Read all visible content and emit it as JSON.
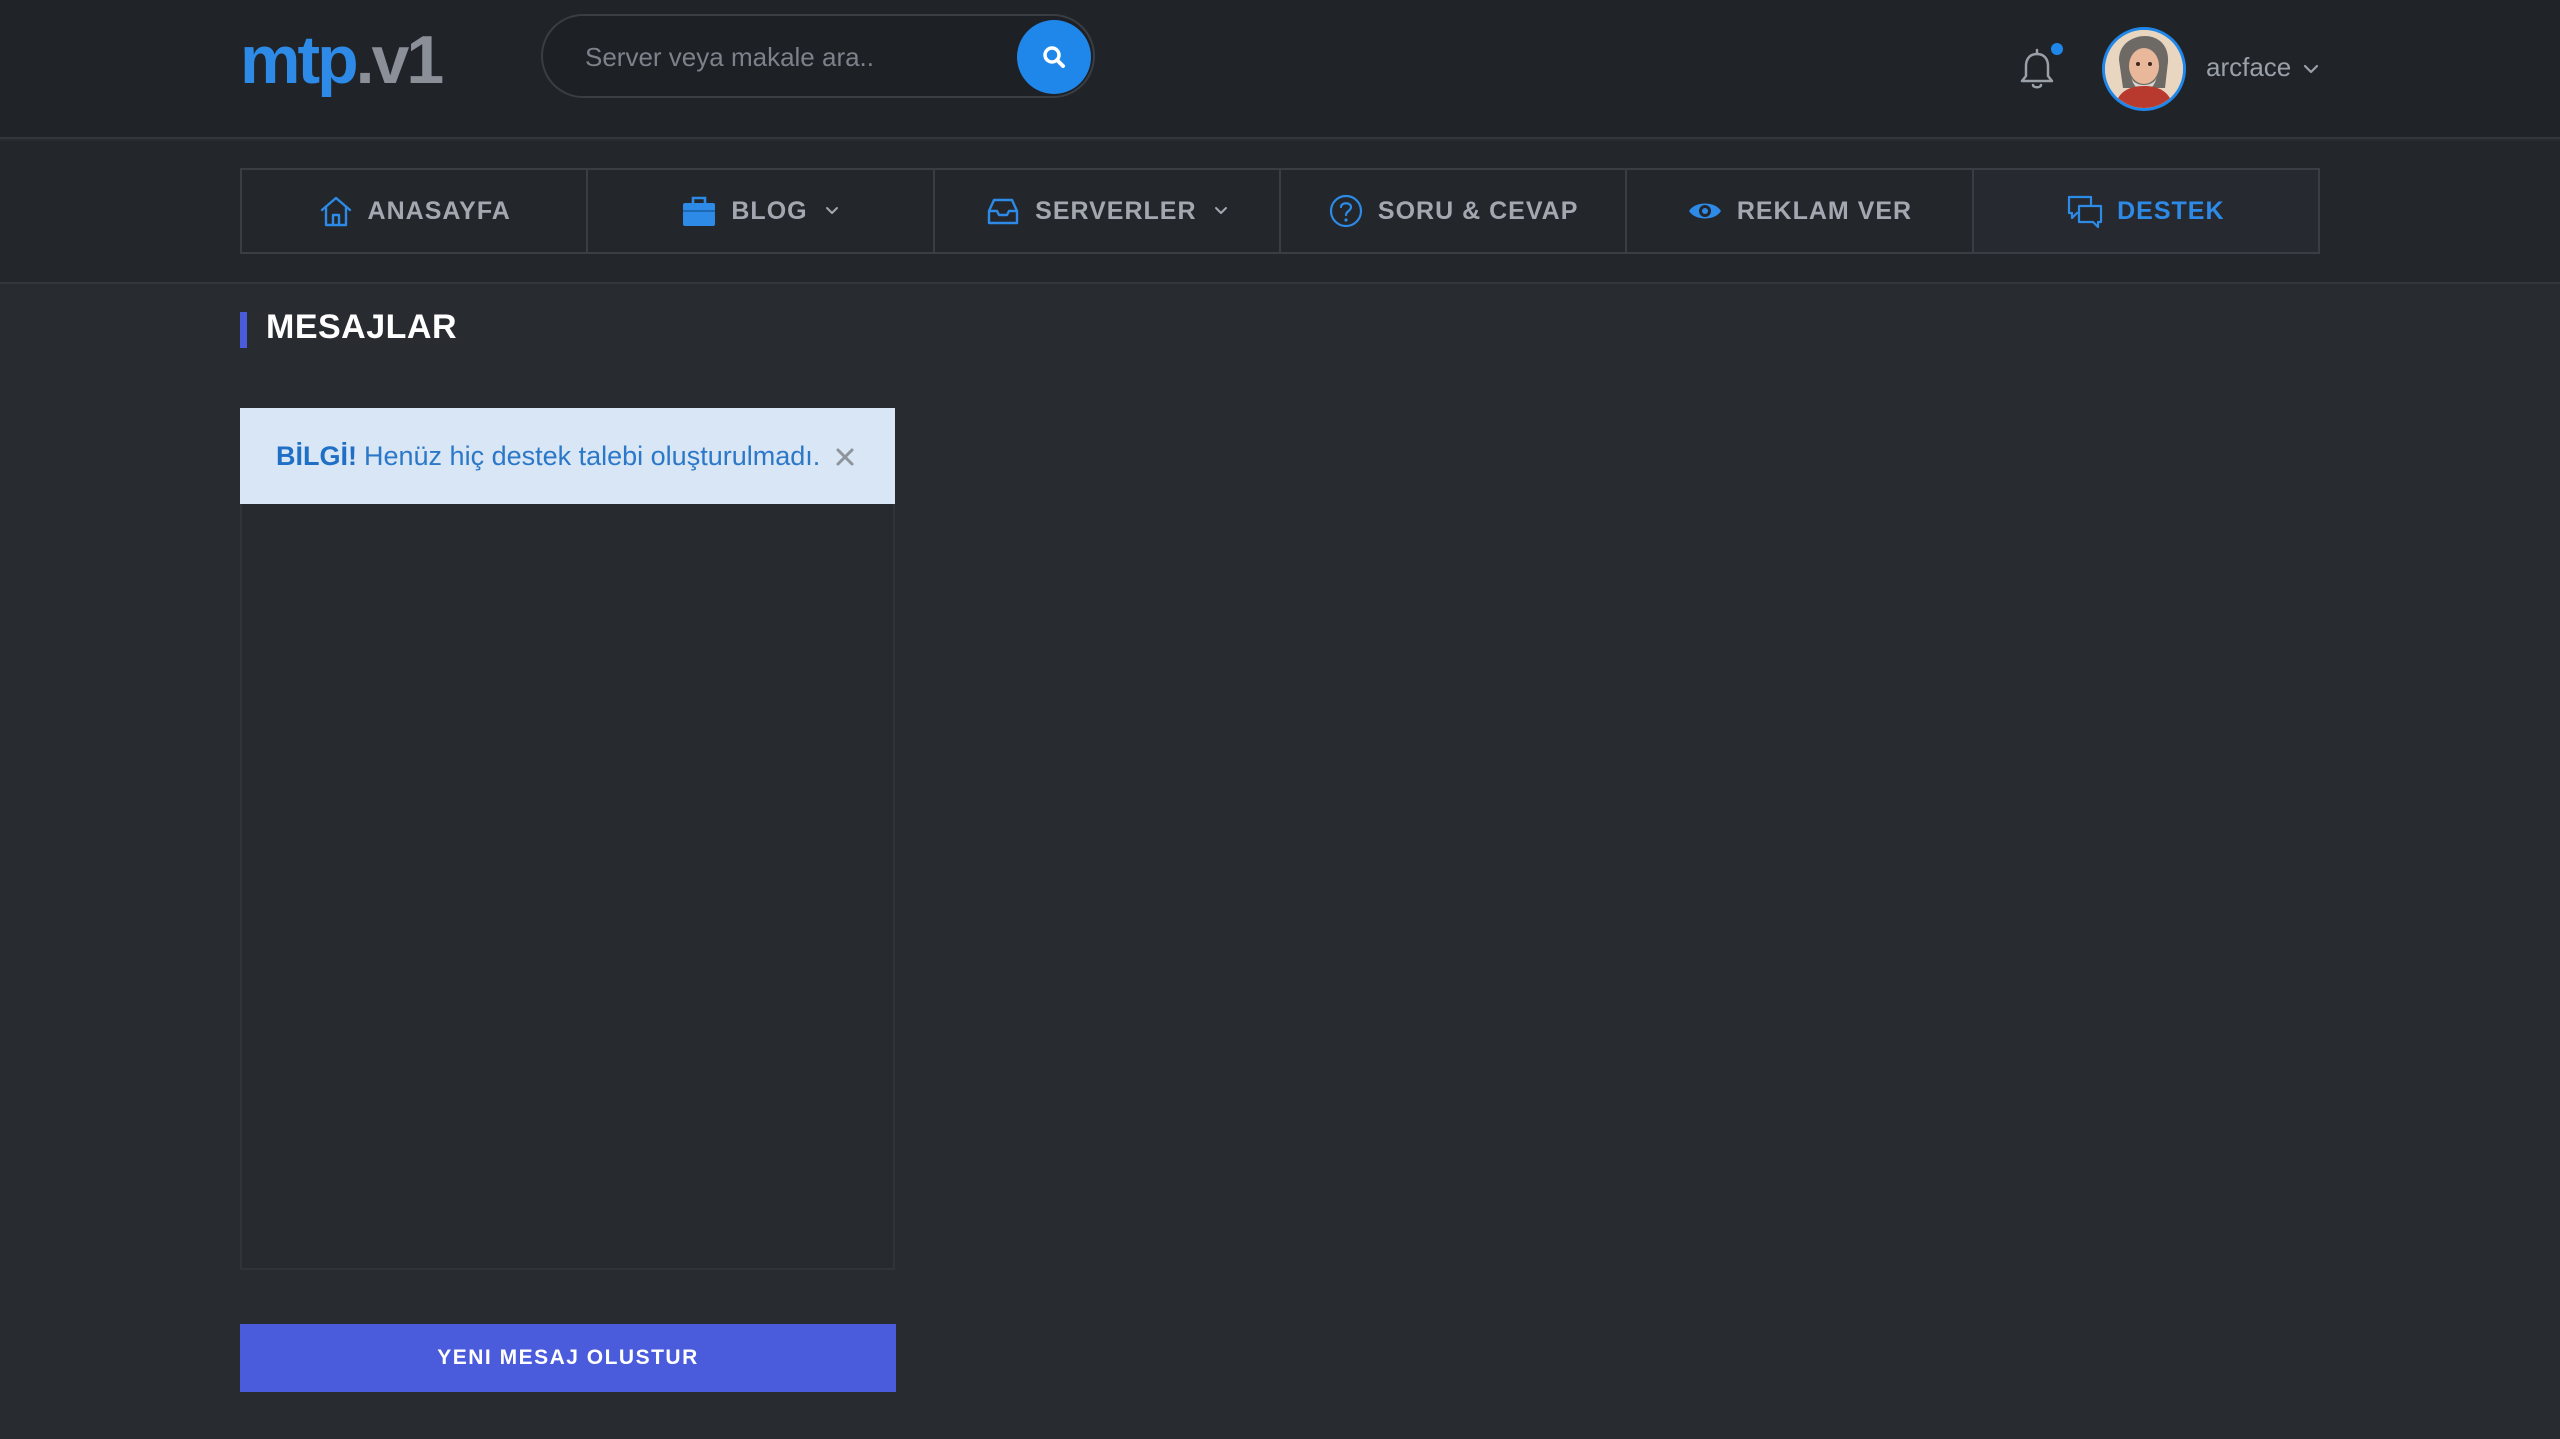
{
  "header": {
    "logo_main": "mtp",
    "logo_suffix": ".v1",
    "search": {
      "placeholder": "Server veya makale ara.."
    },
    "user": {
      "name": "arcface"
    }
  },
  "nav": {
    "items": [
      {
        "label": "ANASAYFA",
        "icon": "home-icon"
      },
      {
        "label": "BLOG",
        "icon": "briefcase-icon",
        "dropdown": true
      },
      {
        "label": "SERVERLER",
        "icon": "inbox-icon",
        "dropdown": true
      },
      {
        "label": "SORU & CEVAP",
        "icon": "question-icon"
      },
      {
        "label": "REKLAM VER",
        "icon": "eye-icon"
      },
      {
        "label": "DESTEK",
        "icon": "chat-icon",
        "active": true
      }
    ]
  },
  "page": {
    "title": "MESAJLAR",
    "alert": {
      "strong": "BİLGİ!",
      "message": "Henüz hiç destek talebi oluşturulmadı."
    },
    "new_button_label": "YENI MESAJ OLUSTUR"
  },
  "colors": {
    "accent": "#1f87ea",
    "button": "#4a5bdc",
    "background": "#282c31",
    "alert_bg": "#d8e6f5"
  }
}
